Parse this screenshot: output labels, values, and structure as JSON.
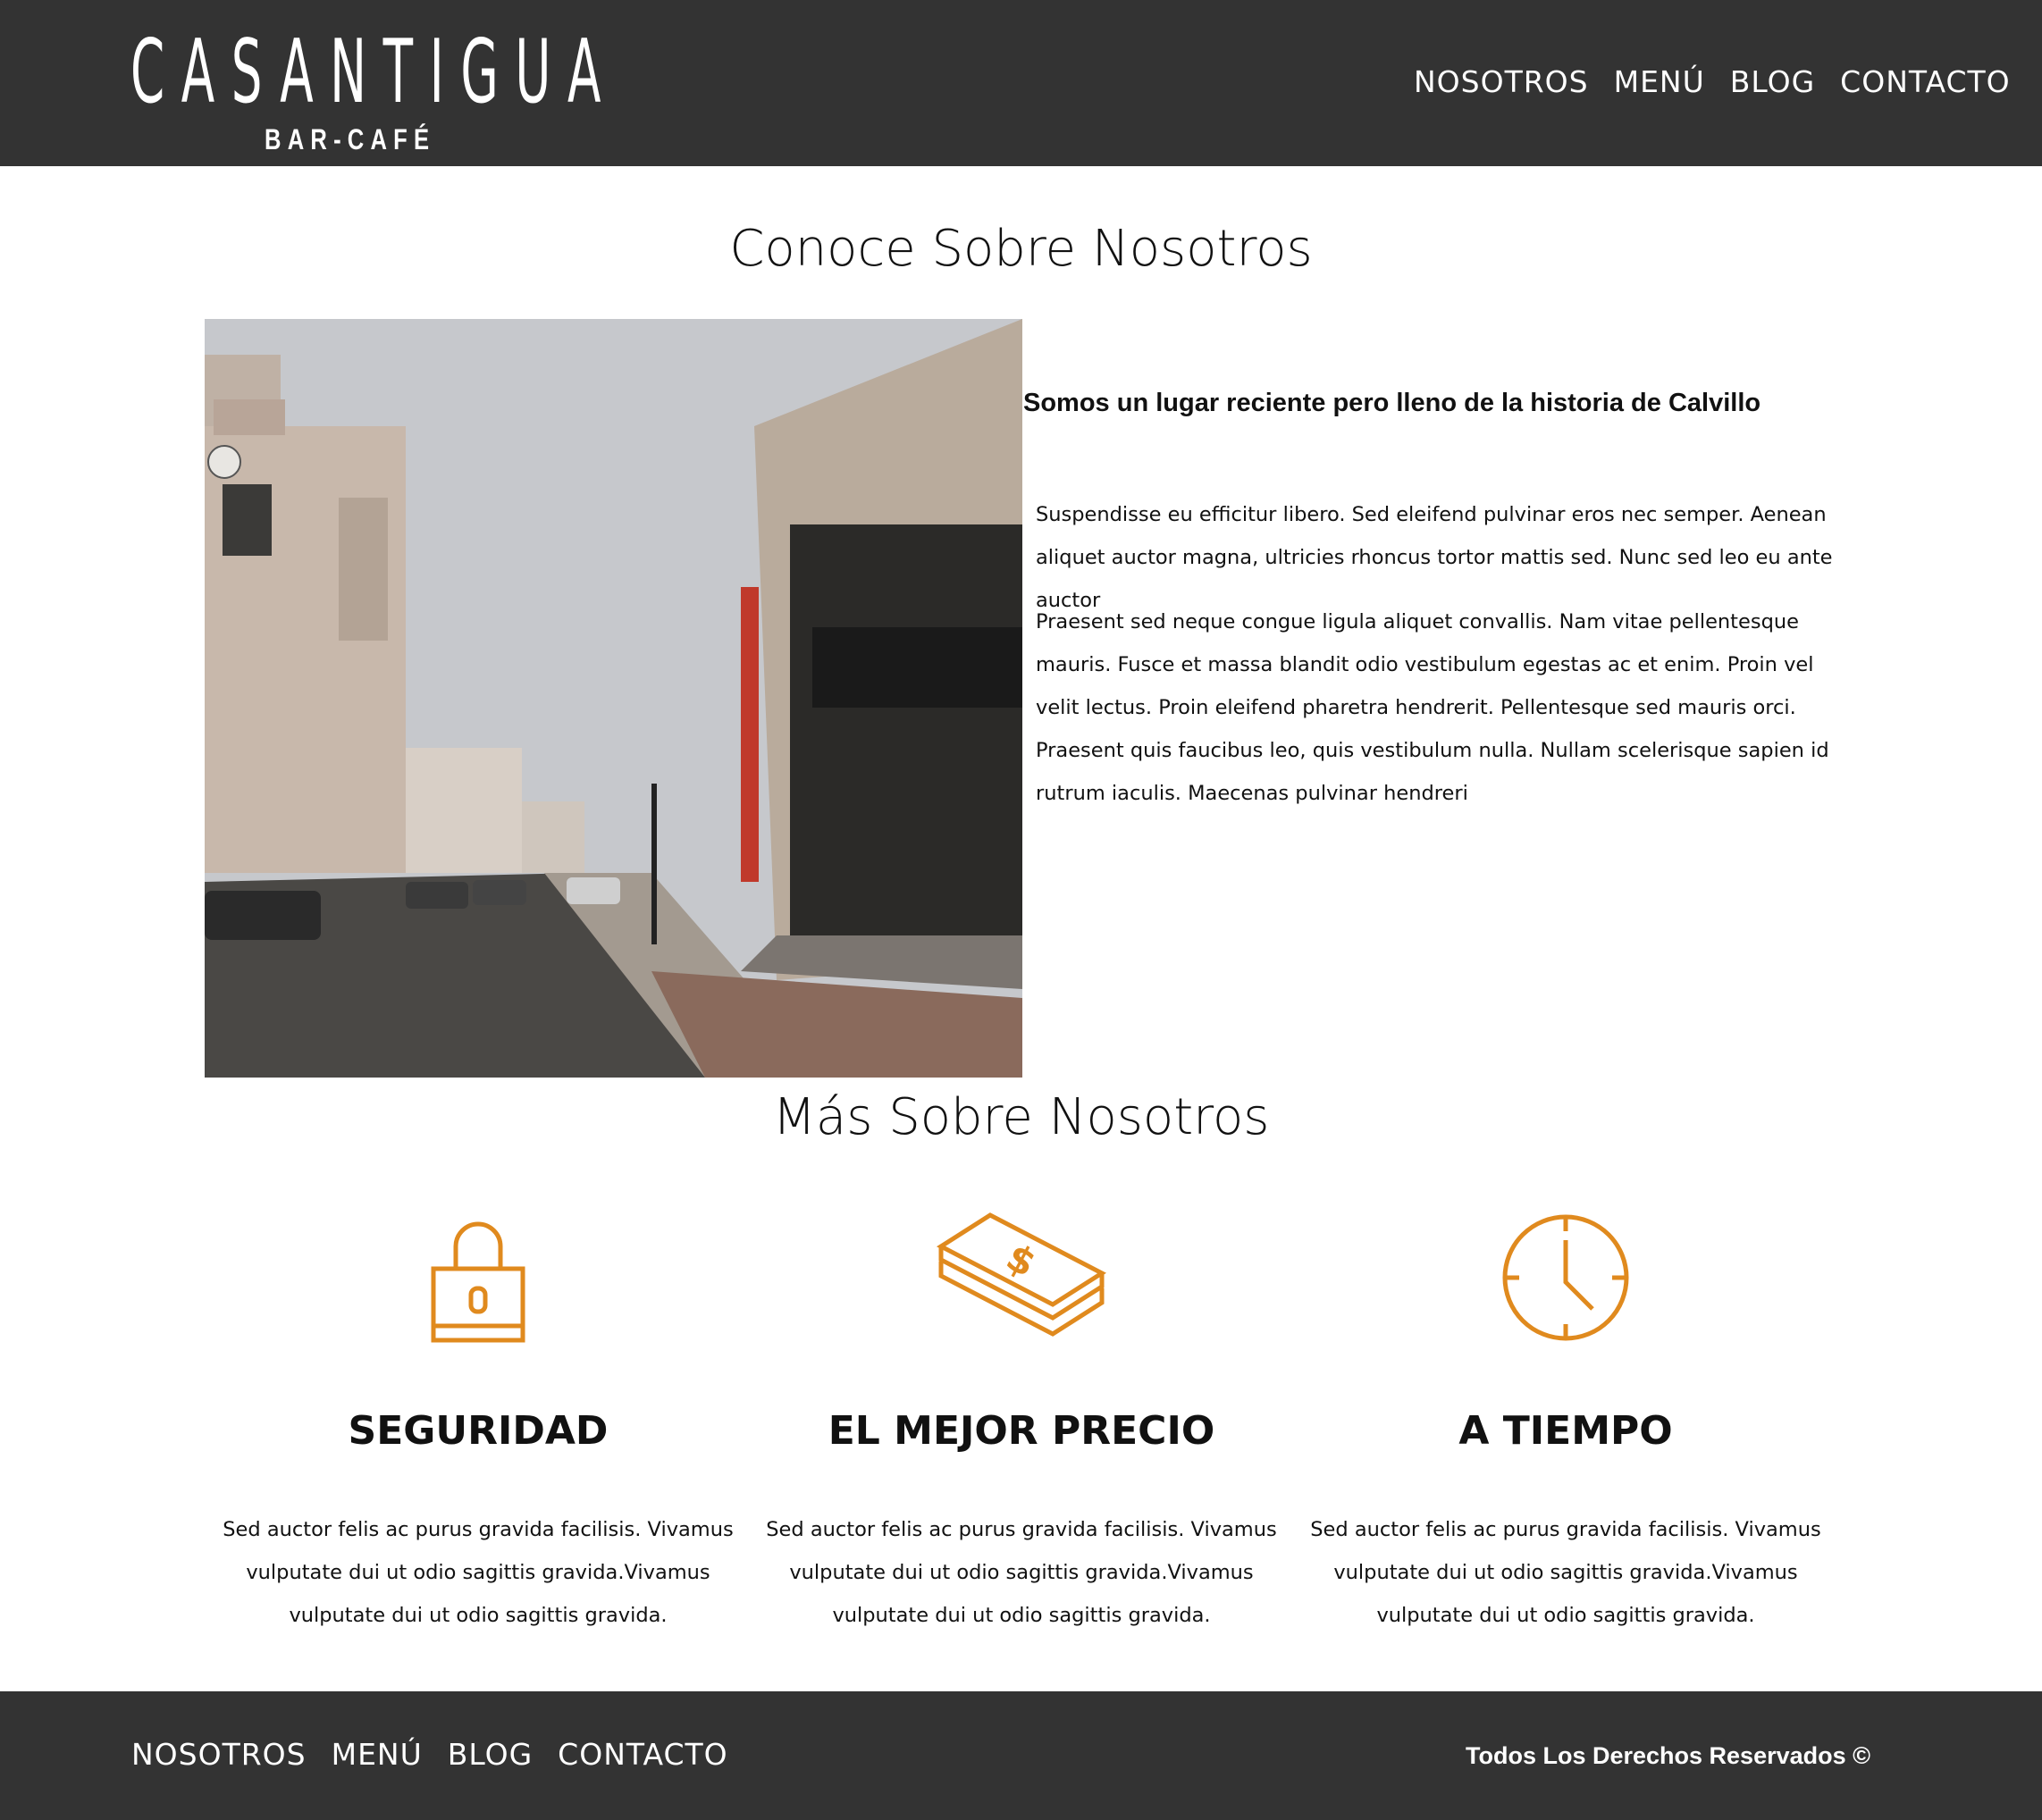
{
  "brand": {
    "name": "CASANTIGUA",
    "subtitle": "BAR-CAFÉ"
  },
  "nav": {
    "items": [
      {
        "label": "NOSOTROS"
      },
      {
        "label": "MENÚ"
      },
      {
        "label": "BLOG"
      },
      {
        "label": "CONTACTO"
      }
    ]
  },
  "about": {
    "title": "Conoce Sobre Nosotros",
    "photo_icon": "street-photo",
    "lead": "Somos un lugar reciente pero lleno de la historia de Calvillo",
    "paragraph1": "Suspendisse eu efficitur libero. Sed eleifend pulvinar eros nec semper. Aenean aliquet auctor magna, ultricies rhoncus tortor mattis sed. Nunc sed leo eu ante auctor",
    "paragraph2": "Praesent sed neque congue ligula aliquet convallis. Nam vitae pellentesque mauris. Fusce et massa blandit odio vestibulum egestas ac et enim. Proin vel velit lectus. Proin eleifend pharetra hendrerit. Pellentesque sed mauris orci. Praesent quis faucibus leo, quis vestibulum nulla. Nullam scelerisque sapien id rutrum iaculis. Maecenas pulvinar hendreri"
  },
  "more": {
    "title": "Más Sobre Nosotros",
    "accent_color": "#E08A1E",
    "features": [
      {
        "icon": "lock-icon",
        "title": "SEGURIDAD",
        "text": "Sed auctor felis ac purus gravida facilisis. Vivamus vulputate dui ut odio sagittis gravida.Vivamus vulputate dui ut odio sagittis gravida."
      },
      {
        "icon": "money-icon",
        "title": "EL MEJOR PRECIO",
        "text": "Sed auctor felis ac purus gravida facilisis. Vivamus vulputate dui ut odio sagittis gravida.Vivamus vulputate dui ut odio sagittis gravida."
      },
      {
        "icon": "clock-icon",
        "title": "A TIEMPO",
        "text": "Sed auctor felis ac purus gravida facilisis. Vivamus vulputate dui ut odio sagittis gravida.Vivamus vulputate dui ut odio sagittis gravida."
      }
    ]
  },
  "footer": {
    "copyright": "Todos Los Derechos Reservados ©"
  },
  "colors": {
    "header_bg": "#333333",
    "text": "#111111"
  }
}
